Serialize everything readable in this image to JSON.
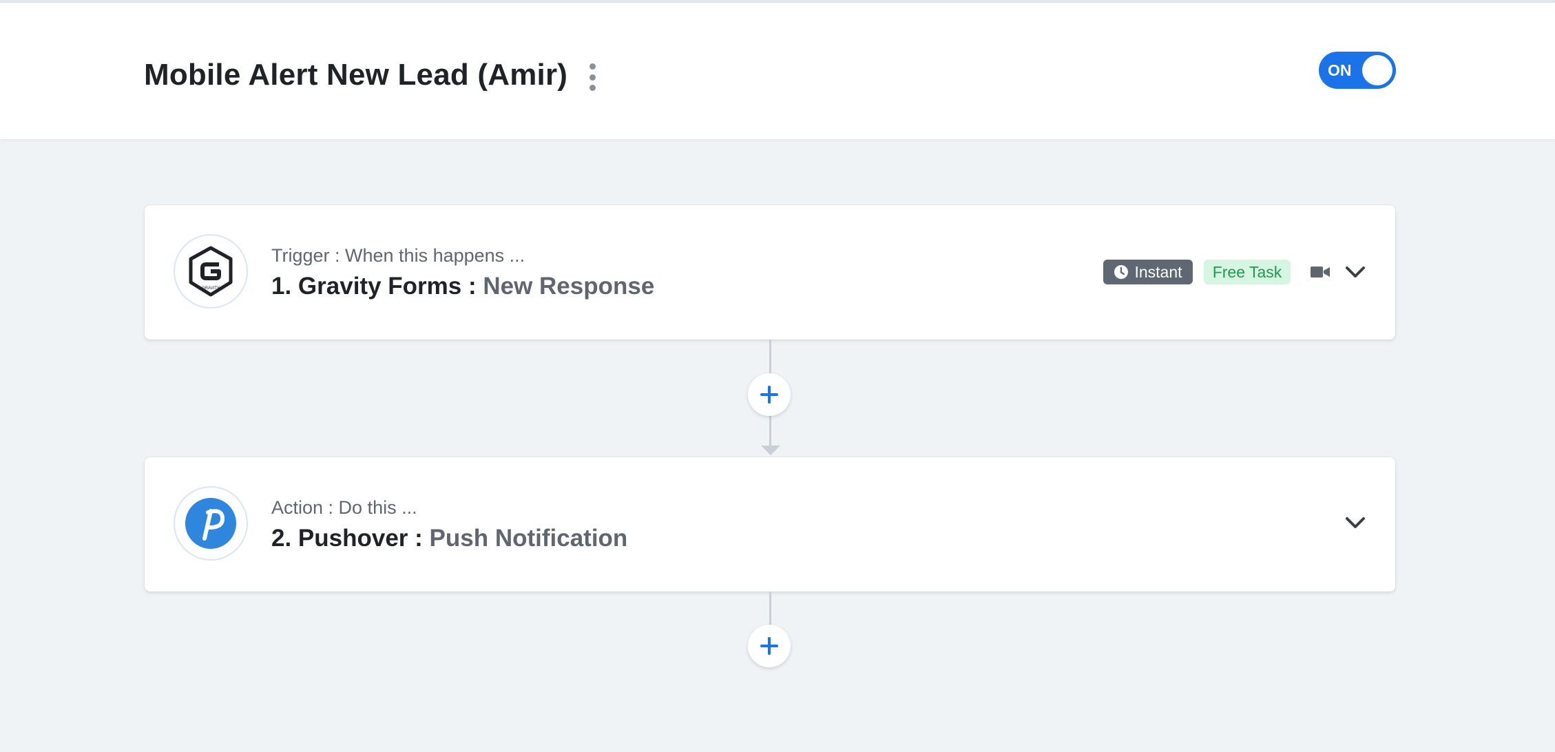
{
  "workflow": {
    "title": "Mobile Alert New Lead (Amir)",
    "toggle_label": "ON"
  },
  "steps": [
    {
      "subtitle": "Trigger : When this happens ...",
      "app": "1. Gravity Forms :",
      "event": "New Response",
      "logo_icon": "gravity-forms-logo",
      "logo_text": "GRAVITY",
      "badges": {
        "instant": "Instant",
        "free_task": "Free Task"
      }
    },
    {
      "subtitle": "Action : Do this ...",
      "app": "2. Pushover :",
      "event": "Push Notification",
      "logo_icon": "pushover-logo",
      "logo_color": "#2e86de"
    }
  ],
  "colors": {
    "accent": "#1a73e8",
    "background": "#f0f3f6",
    "instant_badge": "#5f6872",
    "free_badge_bg": "#d7f5e3",
    "free_badge_text": "#1f9a4e"
  }
}
